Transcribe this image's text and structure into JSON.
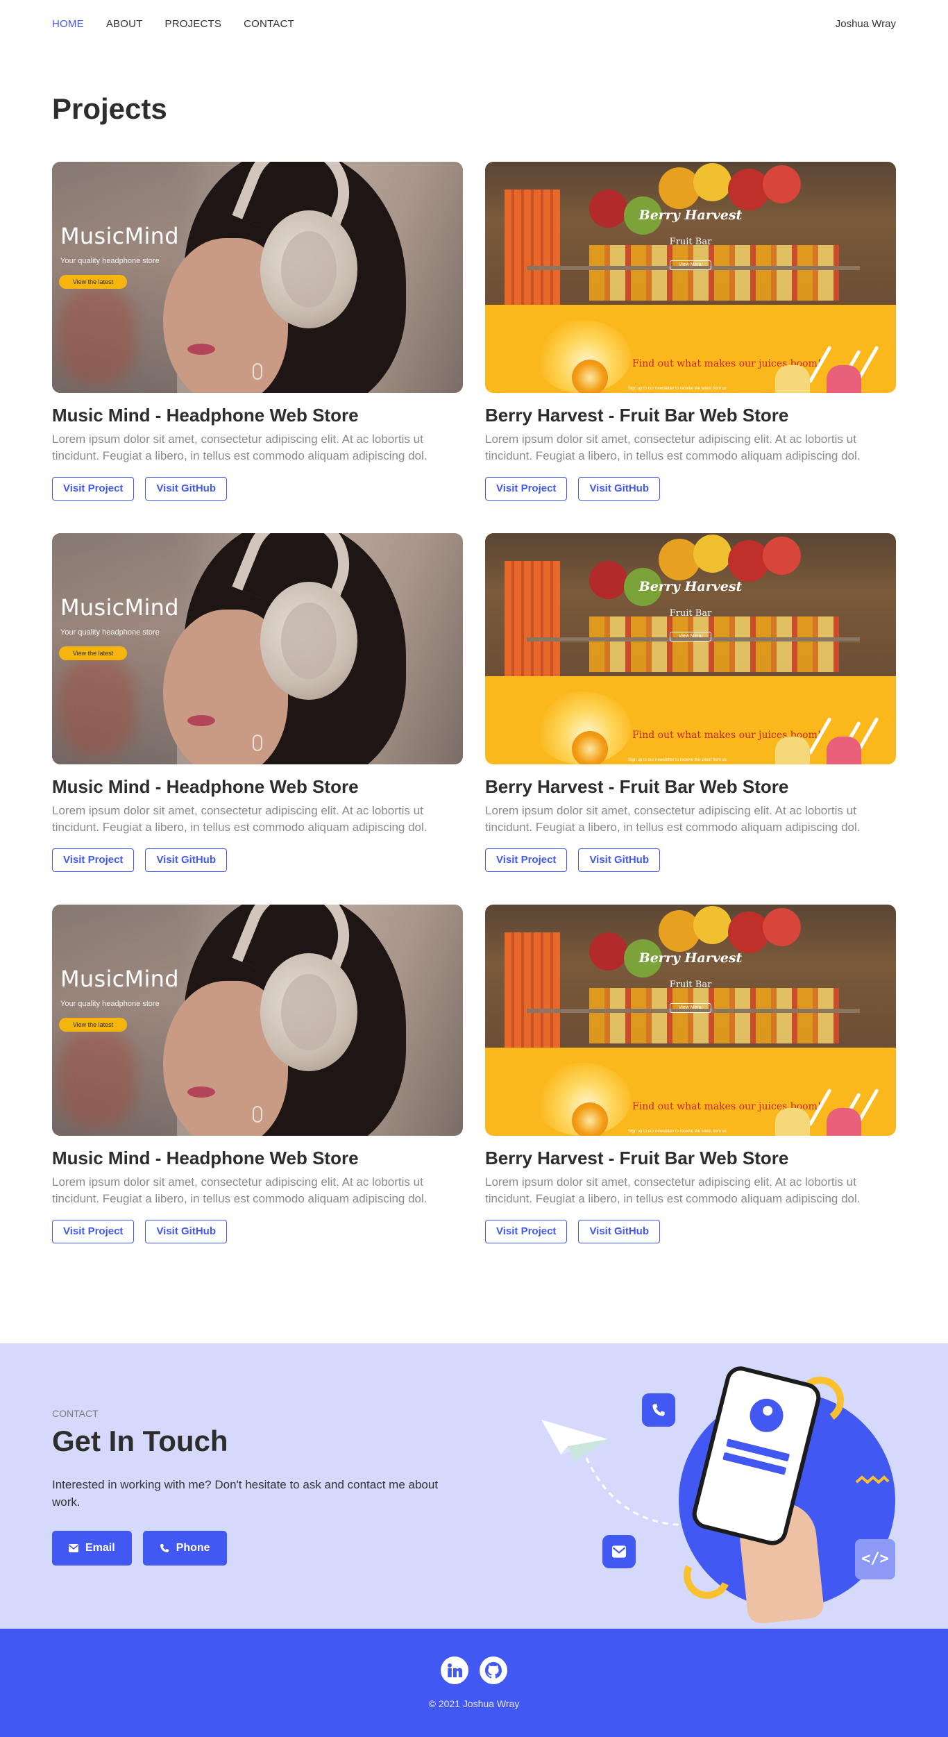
{
  "nav": {
    "links": [
      "HOME",
      "ABOUT",
      "PROJECTS",
      "CONTACT"
    ],
    "active": "HOME",
    "brand": "Joshua Wray"
  },
  "projects": {
    "title": "Projects",
    "items": [
      {
        "type": "music-mind",
        "title": "Music Mind - Headphone Web Store",
        "description": "Lorem ipsum dolor sit amet, consectetur adipiscing elit. At ac lobortis ut tincidunt. Feugiat a libero, in tellus est commodo aliquam adipiscing dol.",
        "visit_label": "Visit Project",
        "github_label": "Visit GitHub",
        "thumb": {
          "brand": "MusicMind",
          "tagline": "Your quality headphone store",
          "cta": "View the latest"
        }
      },
      {
        "type": "berry-harvest",
        "title": "Berry Harvest - Fruit Bar Web Store",
        "description": "Lorem ipsum dolor sit amet, consectetur adipiscing elit. At ac lobortis ut tincidunt. Feugiat a libero, in tellus est commodo aliquam adipiscing dol.",
        "visit_label": "Visit Project",
        "github_label": "Visit GitHub",
        "thumb": {
          "title": "Berry Harvest",
          "sub": "Fruit Bar",
          "menu": "View Menu",
          "headline": "Find out what makes our juices boom!",
          "small": "Sign up to our newsletter to receive the latest from us"
        }
      },
      {
        "type": "music-mind",
        "title": "Music Mind - Headphone Web Store",
        "description": "Lorem ipsum dolor sit amet, consectetur adipiscing elit. At ac lobortis ut tincidunt. Feugiat a libero, in tellus est commodo aliquam adipiscing dol.",
        "visit_label": "Visit Project",
        "github_label": "Visit GitHub",
        "thumb": {
          "brand": "MusicMind",
          "tagline": "Your quality headphone store",
          "cta": "View the latest"
        }
      },
      {
        "type": "berry-harvest",
        "title": "Berry Harvest - Fruit Bar Web Store",
        "description": "Lorem ipsum dolor sit amet, consectetur adipiscing elit. At ac lobortis ut tincidunt. Feugiat a libero, in tellus est commodo aliquam adipiscing dol.",
        "visit_label": "Visit Project",
        "github_label": "Visit GitHub",
        "thumb": {
          "title": "Berry Harvest",
          "sub": "Fruit Bar",
          "menu": "View Menu",
          "headline": "Find out what makes our juices boom!",
          "small": "Sign up to our newsletter to receive the latest from us"
        }
      },
      {
        "type": "music-mind",
        "title": "Music Mind - Headphone Web Store",
        "description": "Lorem ipsum dolor sit amet, consectetur adipiscing elit. At ac lobortis ut tincidunt. Feugiat a libero, in tellus est commodo aliquam adipiscing dol.",
        "visit_label": "Visit Project",
        "github_label": "Visit GitHub",
        "thumb": {
          "brand": "MusicMind",
          "tagline": "Your quality headphone store",
          "cta": "View the latest"
        }
      },
      {
        "type": "berry-harvest",
        "title": "Berry Harvest - Fruit Bar Web Store",
        "description": "Lorem ipsum dolor sit amet, consectetur adipiscing elit. At ac lobortis ut tincidunt. Feugiat a libero, in tellus est commodo aliquam adipiscing dol.",
        "visit_label": "Visit Project",
        "github_label": "Visit GitHub",
        "thumb": {
          "title": "Berry Harvest",
          "sub": "Fruit Bar",
          "menu": "View Menu",
          "headline": "Find out what makes our juices boom!",
          "small": "Sign up to our newsletter to receive the latest from us"
        }
      }
    ]
  },
  "contact": {
    "label": "CONTACT",
    "title": "Get In Touch",
    "text": "Interested in working with me? Don't hesitate to ask and contact me about work.",
    "email_label": "Email",
    "phone_label": "Phone",
    "illustration": {
      "code_symbol": "</>"
    }
  },
  "footer": {
    "icons": [
      "linkedin-icon",
      "github-icon"
    ],
    "copyright": "© 2021 Joshua Wray"
  },
  "colors": {
    "accent": "#4258f2",
    "contact_bg": "#d5dafc",
    "yellow": "#fbc02d",
    "juice_yellow": "#fbb81c"
  }
}
